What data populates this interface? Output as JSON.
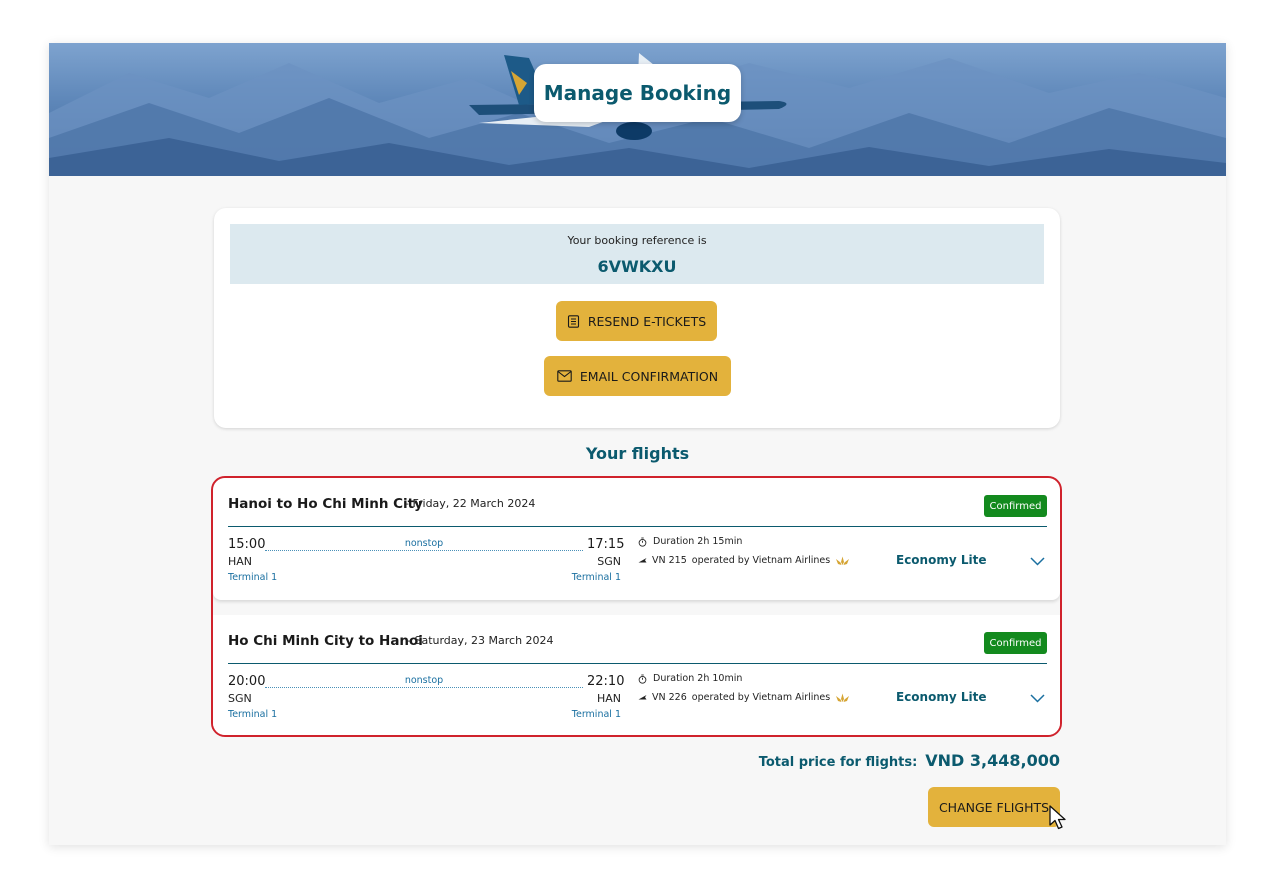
{
  "header": {
    "title": "Manage Booking"
  },
  "booking": {
    "reference_label": "Your booking reference is",
    "reference_code": "6VWKXU",
    "resend_label": "RESEND E-TICKETS",
    "email_label": "EMAIL CONFIRMATION"
  },
  "section_title": "Your flights",
  "flights": [
    {
      "route": "Hanoi to Ho Chi Minh City",
      "date": "- Friday, 22 March 2024",
      "status": "Confirmed",
      "dep_time": "15:00",
      "arr_time": "17:15",
      "stops": "nonstop",
      "dep_code": "HAN",
      "arr_code": "SGN",
      "dep_terminal": "Terminal 1",
      "arr_terminal": "Terminal 1",
      "duration": "Duration 2h 15min",
      "flight_number": "VN 215",
      "operator": "operated by Vietnam Airlines",
      "fare_class": "Economy Lite"
    },
    {
      "route": "Ho Chi Minh City to Hanoi",
      "date": "- Saturday, 23 March 2024",
      "status": "Confirmed",
      "dep_time": "20:00",
      "arr_time": "22:10",
      "stops": "nonstop",
      "dep_code": "SGN",
      "arr_code": "HAN",
      "dep_terminal": "Terminal 1",
      "arr_terminal": "Terminal 1",
      "duration": "Duration 2h 10min",
      "flight_number": "VN 226",
      "operator": "operated by Vietnam Airlines",
      "fare_class": "Economy Lite"
    }
  ],
  "total": {
    "label": "Total price for flights:",
    "value": "VND 3,448,000"
  },
  "change_flights_label": "CHANGE FLIGHTS",
  "colors": {
    "brand_teal": "#0b5a6e",
    "gold_button": "#e3b23c",
    "confirmed_green": "#138a1e",
    "highlight_red": "#d0222c",
    "reference_bg": "#dce9ef"
  },
  "icons": {
    "resend": "document-icon",
    "email": "envelope-icon",
    "duration": "stopwatch-icon",
    "flight": "plane-icon",
    "airline": "lotus-logo-icon",
    "expand": "chevron-down-icon"
  }
}
